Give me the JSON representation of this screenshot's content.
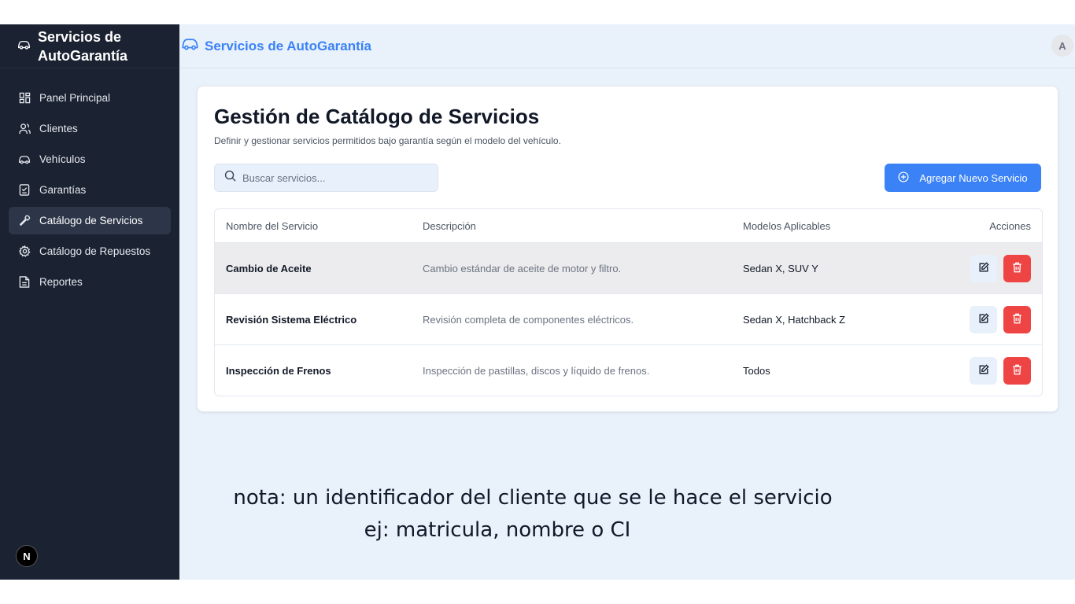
{
  "app": {
    "title": "Servicios de AutoGarantía"
  },
  "sidebar": {
    "items": [
      {
        "label": "Panel Principal",
        "icon": "dashboard-icon",
        "active": false
      },
      {
        "label": "Clientes",
        "icon": "users-icon",
        "active": false
      },
      {
        "label": "Vehículos",
        "icon": "car-icon",
        "active": false
      },
      {
        "label": "Garantías",
        "icon": "checklist-icon",
        "active": false
      },
      {
        "label": "Catálogo de Servicios",
        "icon": "wrench-icon",
        "active": true
      },
      {
        "label": "Catálogo de Repuestos",
        "icon": "gear-icon",
        "active": false
      },
      {
        "label": "Reportes",
        "icon": "document-icon",
        "active": false
      }
    ],
    "badge": "N"
  },
  "topbar": {
    "title": "Servicios de AutoGarantía",
    "avatar": "A"
  },
  "card": {
    "title": "Gestión de Catálogo de Servicios",
    "subtitle": "Definir y gestionar servicios permitidos bajo garantía según el modelo del vehículo.",
    "search_placeholder": "Buscar servicios...",
    "add_label": "Agregar Nuevo Servicio"
  },
  "table": {
    "headers": [
      "Nombre del Servicio",
      "Descripción",
      "Modelos Aplicables",
      "Acciones"
    ],
    "rows": [
      {
        "name": "Cambio de Aceite",
        "description": "Cambio estándar de aceite de motor y filtro.",
        "models": "Sedan X, SUV Y"
      },
      {
        "name": "Revisión Sistema Eléctrico",
        "description": "Revisión completa de componentes eléctricos.",
        "models": "Sedan X, Hatchback Z"
      },
      {
        "name": "Inspección de Frenos",
        "description": "Inspección de pastillas, discos y líquido de frenos.",
        "models": "Todos"
      }
    ]
  },
  "note": {
    "line1": "nota: un  identificador del cliente que se le hace el servicio",
    "line2": "ej: matricula, nombre o CI"
  },
  "colors": {
    "sidebar": "#1b2231",
    "accent": "#3b82f6",
    "danger": "#ef4444",
    "background": "#e9f1fb"
  }
}
